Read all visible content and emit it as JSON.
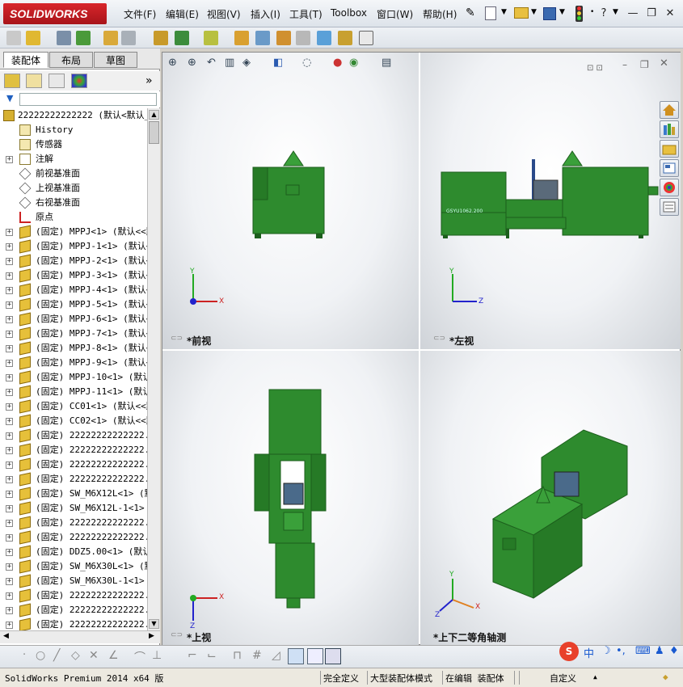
{
  "app": {
    "logo_text": "SOLIDWORKS"
  },
  "menu": [
    "文件(F)",
    "编辑(E)",
    "视图(V)",
    "插入(I)",
    "工具(T)",
    "Toolbox",
    "窗口(W)",
    "帮助(H)"
  ],
  "window_controls": {
    "help": "?",
    "minimize": "—",
    "restore": "❐",
    "close": "✕"
  },
  "tabs": [
    "装配体",
    "布局",
    "草图"
  ],
  "active_tab": "装配体",
  "panel": {
    "expand_label": "»"
  },
  "tree": {
    "root": "22222222222222  (默认<默认_",
    "items": [
      {
        "label": "History",
        "expand": false,
        "icon": "history"
      },
      {
        "label": "传感器",
        "expand": false,
        "icon": "sensor"
      },
      {
        "label": "注解",
        "expand": true,
        "icon": "annotation"
      },
      {
        "label": "前视基准面",
        "expand": false,
        "icon": "plane"
      },
      {
        "label": "上视基准面",
        "expand": false,
        "icon": "plane"
      },
      {
        "label": "右视基准面",
        "expand": false,
        "icon": "plane"
      },
      {
        "label": "原点",
        "expand": false,
        "icon": "origin"
      },
      {
        "label": "(固定) MPPJ<1> (默认<<默",
        "expand": true,
        "icon": "part"
      },
      {
        "label": "(固定) MPPJ-1<1> (默认<",
        "expand": true,
        "icon": "part"
      },
      {
        "label": "(固定) MPPJ-2<1> (默认<",
        "expand": true,
        "icon": "part"
      },
      {
        "label": "(固定) MPPJ-3<1> (默认<",
        "expand": true,
        "icon": "part"
      },
      {
        "label": "(固定) MPPJ-4<1> (默认<",
        "expand": true,
        "icon": "part"
      },
      {
        "label": "(固定) MPPJ-5<1> (默认<",
        "expand": true,
        "icon": "part"
      },
      {
        "label": "(固定) MPPJ-6<1> (默认<",
        "expand": true,
        "icon": "part"
      },
      {
        "label": "(固定) MPPJ-7<1> (默认<",
        "expand": true,
        "icon": "part"
      },
      {
        "label": "(固定) MPPJ-8<1> (默认<",
        "expand": true,
        "icon": "part"
      },
      {
        "label": "(固定) MPPJ-9<1> (默认<",
        "expand": true,
        "icon": "part"
      },
      {
        "label": "(固定) MPPJ-10<1> (默认",
        "expand": true,
        "icon": "part"
      },
      {
        "label": "(固定) MPPJ-11<1> (默认",
        "expand": true,
        "icon": "part"
      },
      {
        "label": "(固定) CC01<1> (默认<<默",
        "expand": true,
        "icon": "part"
      },
      {
        "label": "(固定) CC02<1> (默认<<默",
        "expand": true,
        "icon": "part"
      },
      {
        "label": "(固定) 22222222222222.s",
        "expand": true,
        "icon": "part"
      },
      {
        "label": "(固定) 22222222222222.s",
        "expand": true,
        "icon": "part"
      },
      {
        "label": "(固定) 22222222222222.s",
        "expand": true,
        "icon": "part"
      },
      {
        "label": "(固定) 22222222222222.s",
        "expand": true,
        "icon": "part"
      },
      {
        "label": "(固定) SW_M6X12L<1> (默",
        "expand": true,
        "icon": "part"
      },
      {
        "label": "(固定) SW_M6X12L-1<1> (",
        "expand": true,
        "icon": "part"
      },
      {
        "label": "(固定) 22222222222222.s",
        "expand": true,
        "icon": "part"
      },
      {
        "label": "(固定) 22222222222222.s",
        "expand": true,
        "icon": "part"
      },
      {
        "label": "(固定) DDZ5.00<1> (默认",
        "expand": true,
        "icon": "part"
      },
      {
        "label": "(固定) SW_M6X30L<1> (默",
        "expand": true,
        "icon": "part"
      },
      {
        "label": "(固定) SW_M6X30L-1<1> (",
        "expand": true,
        "icon": "part"
      },
      {
        "label": "(固定) 22222222222222.s",
        "expand": true,
        "icon": "part"
      },
      {
        "label": "(固定) 22222222222222.s",
        "expand": true,
        "icon": "part"
      },
      {
        "label": "(固定) 22222222222222.s",
        "expand": true,
        "icon": "part"
      }
    ]
  },
  "views": {
    "front": "*前视",
    "left": "*左视",
    "top": "*上视",
    "iso": "*上下二等角轴测"
  },
  "axes": {
    "x": "X",
    "y": "Y",
    "z": "Z"
  },
  "model_plate": "GSYU1062.200",
  "status": {
    "version": "SolidWorks Premium 2014 x64 版",
    "defined": "完全定义",
    "mode": "大型装配体模式",
    "editing": "在编辑 装配体",
    "custom": "自定义",
    "custom_arrow": "▲"
  },
  "ime": {
    "mark": "S",
    "label": "中"
  },
  "colors": {
    "model_green": "#2e8b2e",
    "model_dark": "#1c5e1c",
    "accent_red": "#c8141a"
  }
}
